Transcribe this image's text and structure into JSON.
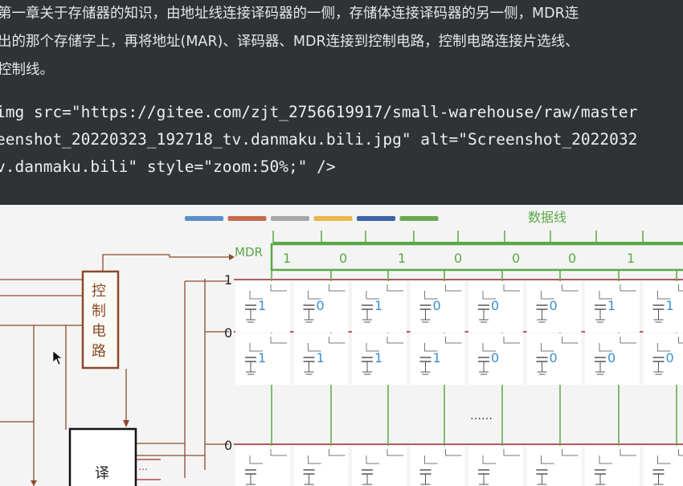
{
  "paragraph": {
    "line1": "第一章关于存储器的知识，由地址线连接译码器的一侧，存储体连接译码器的另一侧，MDR连",
    "line2": "出的那个存储字上，再将地址(MAR)、译码器、MDR连接到控制电路，控制电路连接片选线、",
    "line3": "控制线。"
  },
  "code": {
    "line1": "img src=\"https://gitee.com/zjt_2756619917/small-warehouse/raw/master",
    "line2": "eenshot_20220323_192718_tv.danmaku.bili.jpg\" alt=\"Screenshot_2022032",
    "line3": "v.danmaku.bili\" style=\"zoom:50%;\" />"
  },
  "diagram": {
    "legend_colors": [
      "#5b8fc7",
      "#c86b4a",
      "#a8a8a8",
      "#e8b84a",
      "#3f63a8",
      "#6aa84f"
    ],
    "data_line_label": "数据线",
    "mdr_label": "MDR",
    "mdr_bits": [
      "1",
      "0",
      "1",
      "0",
      "0",
      "0",
      "1"
    ],
    "control_circuit_label": [
      "控",
      "制",
      "电",
      "路"
    ],
    "decoder_label": "译",
    "word_line_labels": [
      "1",
      "0",
      "0"
    ],
    "row1_bits": [
      "1",
      "0",
      "1",
      "0",
      "0",
      "0",
      "1",
      "1"
    ],
    "row2_bits": [
      "1",
      "1",
      "1",
      "1",
      "0",
      "0",
      "0",
      "0"
    ],
    "ellipsis": "……",
    "decoder_ellipsis": "…",
    "colors": {
      "brown": "#8b4a2b",
      "green": "#5aa845",
      "cell_blue": "#3a8fd0",
      "wordline": "#9a2b2b"
    }
  }
}
